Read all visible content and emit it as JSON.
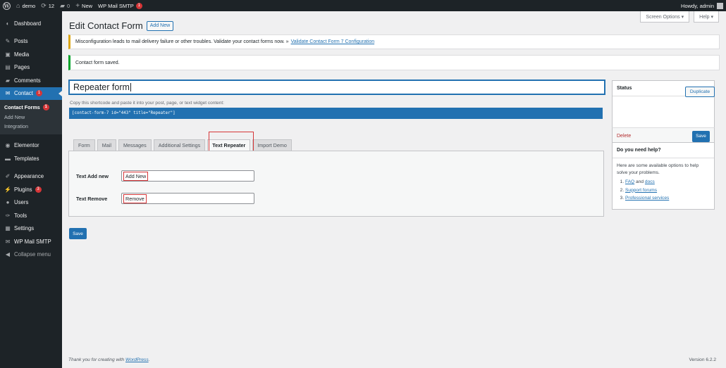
{
  "adminbar": {
    "site_name": "demo",
    "updates_count": "12",
    "comments_count": "0",
    "new_label": "New",
    "smtp_label": "WP Mail SMTP",
    "smtp_badge": "1",
    "howdy": "Howdy, admin"
  },
  "sidebar": {
    "dashboard": "Dashboard",
    "posts": "Posts",
    "media": "Media",
    "pages": "Pages",
    "comments": "Comments",
    "contact": "Contact",
    "contact_badge": "1",
    "sub_contact_forms": "Contact Forms",
    "sub_contact_forms_badge": "1",
    "sub_add_new": "Add New",
    "sub_integration": "Integration",
    "elementor": "Elementor",
    "templates": "Templates",
    "appearance": "Appearance",
    "plugins": "Plugins",
    "plugins_badge": "3",
    "users": "Users",
    "tools": "Tools",
    "settings": "Settings",
    "wp_mail_smtp": "WP Mail SMTP",
    "collapse": "Collapse menu"
  },
  "screen_meta": {
    "screen_options": "Screen Options ▾",
    "help": "Help ▾"
  },
  "header": {
    "title": "Edit Contact Form",
    "add_new": "Add New"
  },
  "notices": {
    "warning_text": "Misconfiguration leads to mail delivery failure or other troubles. Validate your contact forms now. »",
    "warning_link": "Validate Contact Form 7 Configuration",
    "saved_text": "Contact form saved."
  },
  "form": {
    "title_value": "Repeater form",
    "shortcode_label": "Copy this shortcode and paste it into your post, page, or text widget content:",
    "shortcode": "[contact-form-7 id=\"443\" title=\"Repeater\"]"
  },
  "tabs": [
    "Form",
    "Mail",
    "Messages",
    "Additional Settings",
    "Text Repeater",
    "Import Demo"
  ],
  "active_tab_index": 4,
  "panel": {
    "add_new_label": "Text Add new",
    "add_new_value": "Add New",
    "remove_label": "Text Remove",
    "remove_value": "Remove"
  },
  "save_label": "Save",
  "status_box": {
    "title": "Status",
    "duplicate": "Duplicate",
    "delete": "Delete",
    "save": "Save"
  },
  "help_box": {
    "title": "Do you need help?",
    "intro": "Here are some available options to help solve your problems.",
    "item1_link_a": "FAQ",
    "item1_and": "and",
    "item1_link_b": "docs",
    "item2_link": "Support forums",
    "item3_link": "Professional services"
  },
  "footer": {
    "thanks_prefix": "Thank you for creating with",
    "wordpress_link": "WordPress",
    "version": "Version 6.2.2"
  },
  "colors": {
    "admin_dark": "#1d2327",
    "accent_blue": "#2271b1",
    "highlight_red": "#d63638",
    "warning_yellow": "#dba617",
    "success_green": "#00a32a"
  }
}
